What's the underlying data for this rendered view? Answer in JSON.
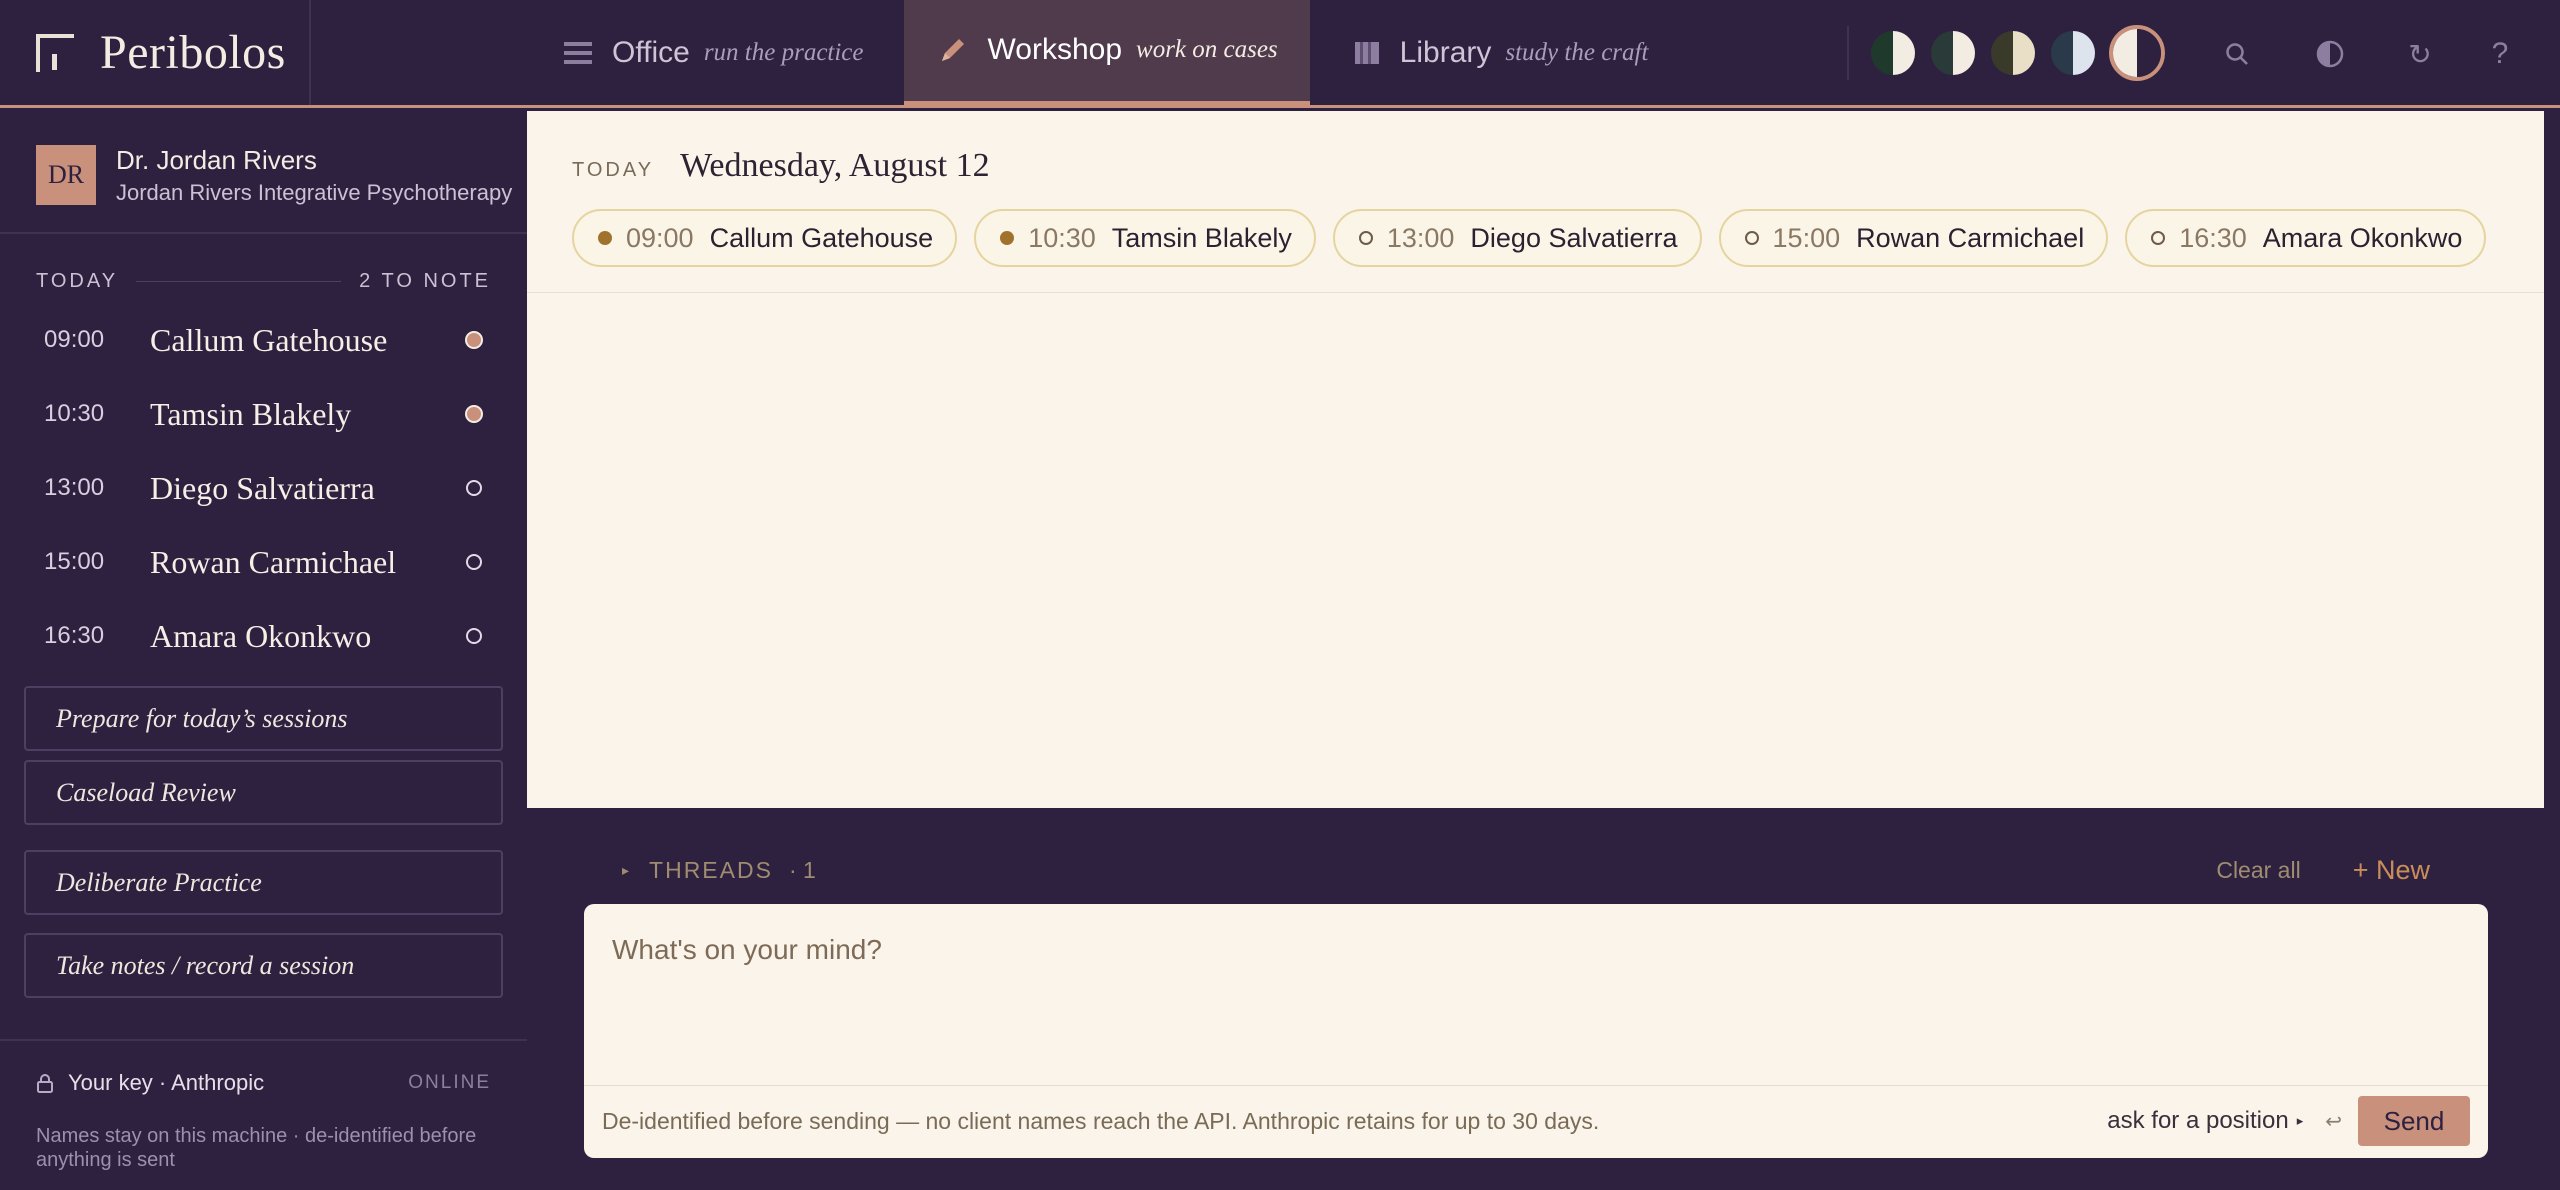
{
  "brand": {
    "name": "Peribolos"
  },
  "nav": [
    {
      "label": "Office",
      "subtitle": "run the practice",
      "icon": "menu-icon",
      "active": false
    },
    {
      "label": "Workshop",
      "subtitle": "work on cases",
      "icon": "pencil-icon",
      "active": true
    },
    {
      "label": "Library",
      "subtitle": "study the craft",
      "icon": "book-icon",
      "active": false
    }
  ],
  "themes": [
    {
      "left": "#1f3a2c",
      "right": "#f3ece2",
      "selected": false
    },
    {
      "left": "#2a3a38",
      "right": "#f3ece2",
      "selected": false
    },
    {
      "left": "#3a3a2a",
      "right": "#e8dfc6",
      "selected": false
    },
    {
      "left": "#2a3a4a",
      "right": "#dde4ee",
      "selected": false
    },
    {
      "left": "#f3ece2",
      "right": "#2e2140",
      "selected": true
    }
  ],
  "toolbar_icons": [
    "search-icon",
    "contrast-icon",
    "refresh-icon",
    "help-icon"
  ],
  "profile": {
    "initials": "DR",
    "name": "Dr. Jordan Rivers",
    "practice": "Jordan Rivers Integrative Psychotherapy"
  },
  "sidebar": {
    "today_label": "TODAY",
    "note_count": "2 TO NOTE",
    "appointments": [
      {
        "time": "09:00",
        "name": "Callum Gatehouse",
        "flagged": true
      },
      {
        "time": "10:30",
        "name": "Tamsin Blakely",
        "flagged": true
      },
      {
        "time": "13:00",
        "name": "Diego Salvatierra",
        "flagged": false
      },
      {
        "time": "15:00",
        "name": "Rowan Carmichael",
        "flagged": false
      },
      {
        "time": "16:30",
        "name": "Amara Okonkwo",
        "flagged": false
      }
    ],
    "actions": [
      "Prepare for today’s sessions",
      "Caseload Review",
      "Deliberate Practice",
      "Take notes / record a session"
    ],
    "key_label": "Your key · Anthropic",
    "key_status": "ONLINE",
    "key_note": "Names stay on this machine · de-identified before anything is sent"
  },
  "main": {
    "today_label": "TODAY",
    "date": "Wednesday, August 12",
    "chips": [
      {
        "time": "09:00",
        "name": "Callum Gatehouse",
        "flagged": true
      },
      {
        "time": "10:30",
        "name": "Tamsin Blakely",
        "flagged": true
      },
      {
        "time": "13:00",
        "name": "Diego Salvatierra",
        "flagged": false
      },
      {
        "time": "15:00",
        "name": "Rowan Carmichael",
        "flagged": false
      },
      {
        "time": "16:30",
        "name": "Amara Okonkwo",
        "flagged": false
      }
    ]
  },
  "threads": {
    "caret": "▸",
    "label": "THREADS",
    "count": "· 1",
    "clear_label": "Clear all",
    "new_label": "+ New"
  },
  "composer": {
    "placeholder": "What's on your mind?",
    "value": "",
    "privacy_note": "De-identified before sending — no client names reach the API. Anthropic retains for up to 30 days.",
    "position_label": "ask for a position",
    "position_caret": "▸",
    "enter_hint": "↩",
    "send_label": "Send"
  },
  "colors": {
    "accent": "#c9907c",
    "sidebar_bg": "#2e2140",
    "canvas_bg": "#faf4ea",
    "chip_border": "#e6d49f"
  }
}
